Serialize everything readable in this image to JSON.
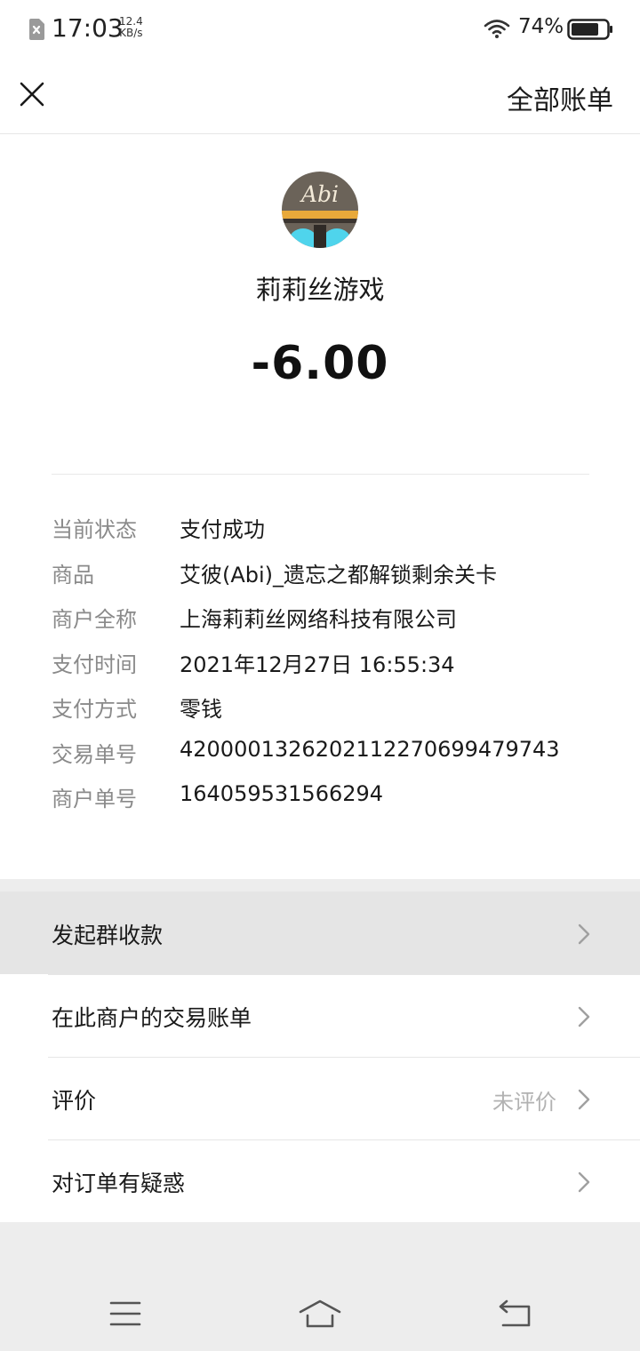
{
  "status_bar": {
    "time": "17:03",
    "net_speed_value": "12.4",
    "net_speed_unit": "KB/s",
    "battery_percent": "74%",
    "icons": [
      "sim-error-icon",
      "wifi-icon",
      "battery-icon"
    ]
  },
  "header": {
    "close_icon": "close-icon",
    "all_bills_label": "全部账单"
  },
  "transaction": {
    "merchant_short_name": "莉莉丝游戏",
    "avatar_text": "Abi",
    "amount": "-6.00",
    "details": [
      {
        "label": "当前状态",
        "value": "支付成功"
      },
      {
        "label": "商品",
        "value": "艾彼(Abi)_遗忘之都解锁剩余关卡"
      },
      {
        "label": "商户全称",
        "value": "上海莉莉丝网络科技有限公司"
      },
      {
        "label": "支付时间",
        "value": "2021年12月27日 16:55:34"
      },
      {
        "label": "支付方式",
        "value": "零钱"
      },
      {
        "label": "交易单号",
        "value": "4200001326202112270699479743"
      },
      {
        "label": "商户单号",
        "value": "164059531566294"
      }
    ]
  },
  "actions": [
    {
      "label": "发起群收款",
      "extra": ""
    },
    {
      "label": "在此商户的交易账单",
      "extra": ""
    },
    {
      "label": "评价",
      "extra": "未评价"
    },
    {
      "label": "对订单有疑惑",
      "extra": ""
    }
  ],
  "nav_bar": {
    "icons": [
      "menu-icon",
      "home-icon",
      "back-icon"
    ]
  },
  "colors": {
    "background": "#ededed",
    "card": "#ffffff",
    "label_gray": "#8a8a8a",
    "pressed_row": "#e5e5e5",
    "avatar_yellow": "#e9a93a",
    "avatar_cyan": "#4fd4ec"
  }
}
